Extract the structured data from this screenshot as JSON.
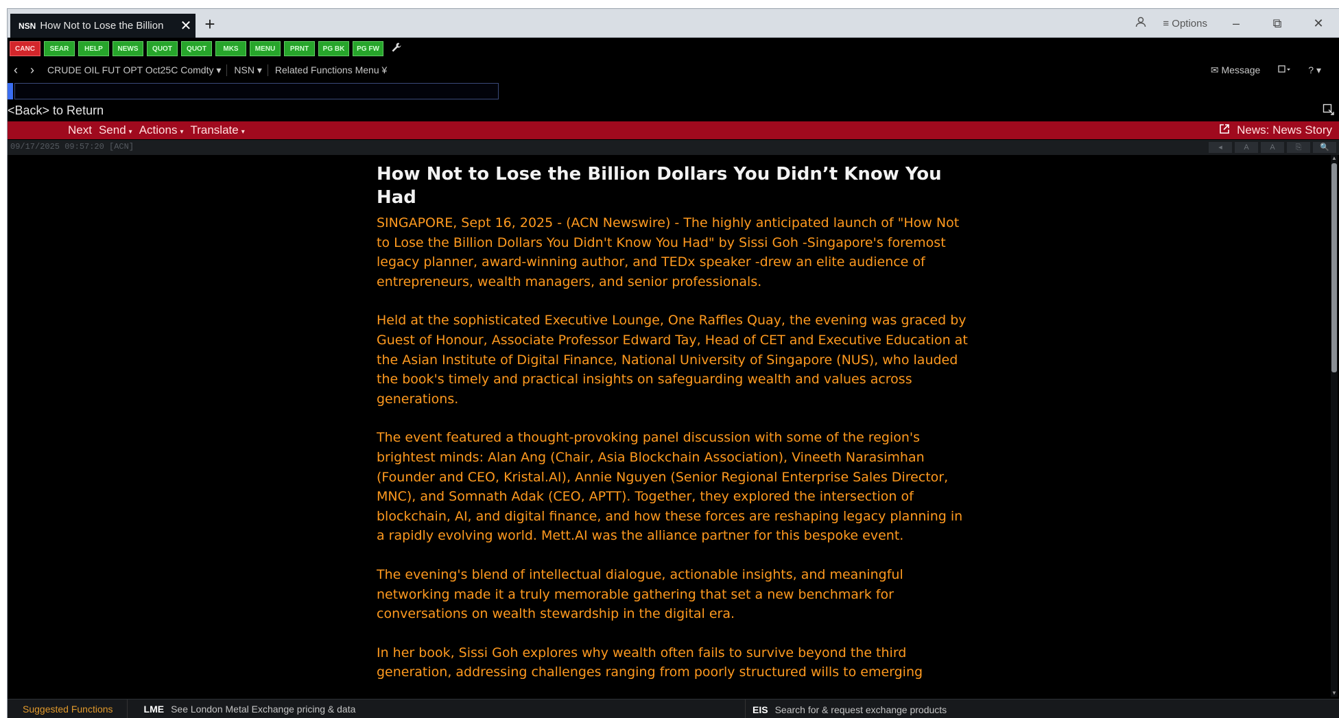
{
  "tab": {
    "code": "NSN",
    "title": "How Not to Lose the Billion",
    "close_glyph": "✕",
    "new_tab_glyph": "+"
  },
  "window": {
    "options_label": "≡ Options",
    "minimize": "–",
    "restore": "⧉",
    "close": "✕"
  },
  "function_keys": [
    "CANC",
    "SEAR",
    "HELP",
    "NEWS",
    "QUOT",
    "QUOT",
    "MKS",
    "MENU",
    "PRNT",
    "PG BK",
    "PG FW"
  ],
  "nav": {
    "back": "‹",
    "forward": "›",
    "security": "CRUDE OIL FUT OPT Oct25C Comdty ▾",
    "function": "NSN ▾",
    "related": "Related Functions Menu ¥",
    "message": "✉ Message",
    "help": "? ▾"
  },
  "command": {
    "value": ""
  },
  "back_text": "<Back> to Return",
  "action_bar": {
    "next": "Next",
    "send": "Send",
    "actions": "Actions",
    "translate": "Translate",
    "news_label": "News: News Story"
  },
  "status": {
    "timestamp": "09/17/2025 09:57:20 [ACN]",
    "tools": [
      "◂",
      "A",
      "A",
      "⎘",
      "🔍"
    ]
  },
  "story": {
    "headline": "How Not to Lose the Billion Dollars You Didn’t Know You Had",
    "paragraphs": [
      "SINGAPORE, Sept 16, 2025 - (ACN Newswire) - The highly anticipated launch of \"How Not to Lose the Billion Dollars You Didn't Know You Had\" by Sissi Goh -Singapore's foremost legacy planner, award-winning author, and TEDx speaker -drew an elite audience of entrepreneurs, wealth managers, and senior professionals.",
      "Held at the sophisticated Executive Lounge, One Raffles Quay, the evening was graced by Guest of Honour, Associate Professor Edward Tay, Head of CET and Executive Education at the Asian Institute of Digital Finance, National University of Singapore (NUS), who lauded the book's timely and practical insights on safeguarding wealth and values across generations.",
      "The event featured a thought-provoking panel discussion with some of the region's brightest minds: Alan Ang (Chair, Asia Blockchain Association), Vineeth Narasimhan (Founder and CEO, Kristal.AI), Annie Nguyen (Senior Regional Enterprise Sales Director, MNC), and Somnath Adak (CEO, APTT). Together, they explored the intersection of blockchain, AI, and digital finance, and how these forces are reshaping legacy planning in a rapidly evolving world. Mett.AI was the alliance partner for this bespoke event.",
      "The evening's blend of intellectual dialogue, actionable insights, and meaningful networking made it a truly memorable gathering that set a new benchmark for conversations on wealth stewardship in the digital era.",
      "In her book, Sissi Goh explores why wealth often fails to survive beyond the third generation, addressing challenges ranging from poorly structured wills to emerging"
    ]
  },
  "bottom": {
    "suggested": "Suggested Functions",
    "lme_code": "LME",
    "lme_text": "See London Metal Exchange pricing & data",
    "eis_code": "EIS",
    "eis_text": "Search for & request exchange products"
  },
  "colors": {
    "story_text": "#ff9a1f",
    "action_bar": "#a00a1e",
    "fkey_green": "#27a52b",
    "fkey_red": "#d3262b"
  }
}
